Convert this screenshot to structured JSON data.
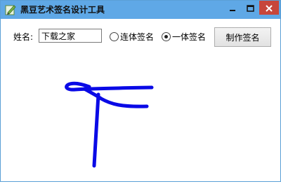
{
  "window": {
    "title": "黑豆艺术签名设计工具",
    "controls": {
      "minimize_icon": "minimize-icon",
      "maximize_icon": "maximize-icon",
      "close_icon": "close-icon"
    },
    "colors": {
      "titlebar": "#5fa8e6",
      "close_button": "#c7463b"
    }
  },
  "form": {
    "name_label": "姓名:",
    "name_value": "下载之家",
    "radio_options": [
      {
        "label": "连体签名",
        "checked": false
      },
      {
        "label": "一体签名",
        "checked": true
      }
    ],
    "make_button_label": "制作签名"
  },
  "signature": {
    "stroke_color": "#0a0ae6"
  }
}
